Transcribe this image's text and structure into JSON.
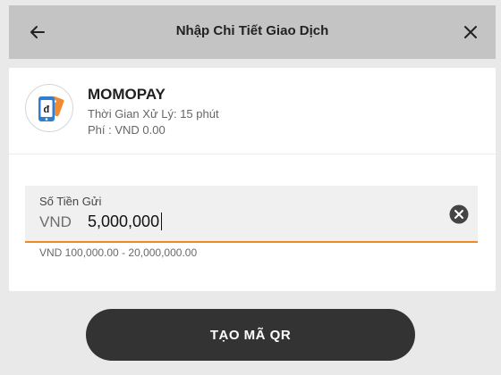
{
  "header": {
    "title": "Nhập Chi Tiết Giao Dịch",
    "back_icon": "arrow-left-icon",
    "close_icon": "close-icon"
  },
  "provider": {
    "name": "MOMOPAY",
    "processing_time": "Thời Gian Xử Lý: 15 phút",
    "fee": "Phí : VND 0.00",
    "logo_icon": "momopay-logo-icon"
  },
  "amount": {
    "label": "Số Tiền Gửi",
    "currency": "VND",
    "value": "5,000,000",
    "clear_icon": "clear-icon",
    "range": "VND 100,000.00 - 20,000,000.00"
  },
  "action": {
    "button_label": "TẠO MÃ QR"
  },
  "colors": {
    "header_bg": "#c4c4c4",
    "accent_underline": "#f08a24",
    "button_bg": "#333333",
    "page_bg": "#e9e9e9"
  }
}
